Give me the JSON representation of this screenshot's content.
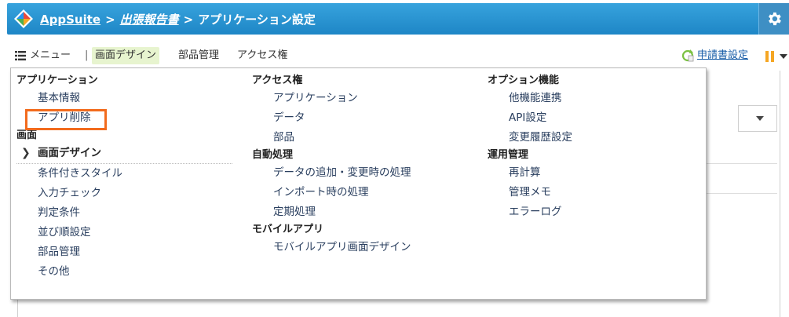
{
  "header": {
    "app_name": "AppSuite",
    "sep1": ">",
    "app_link": "出張報告書",
    "sep2": ">",
    "page_title": "アプリケーション設定"
  },
  "toolbar": {
    "menu_label": "メニュー",
    "divider": "|",
    "design_label": "画面デザイン",
    "parts_label": "部品管理",
    "access_label": "アクセス権",
    "request_label": "申請書設定"
  },
  "menu": {
    "col1": {
      "app_section": "アプリケーション",
      "app_items": [
        "基本情報",
        "アプリ削除"
      ],
      "screen_section": "画面",
      "screen_items": [
        "画面デザイン",
        "条件付きスタイル",
        "入力チェック",
        "判定条件",
        "並び順設定",
        "部品管理",
        "その他"
      ]
    },
    "col2": {
      "access_section": "アクセス権",
      "access_items": [
        "アプリケーション",
        "データ",
        "部品"
      ],
      "auto_section": "自動処理",
      "auto_items": [
        "データの追加・変更時の処理",
        "インポート時の処理",
        "定期処理"
      ],
      "mobile_section": "モバイルアプリ",
      "mobile_items": [
        "モバイルアプリ画面デザイン"
      ]
    },
    "col3": {
      "option_section": "オプション機能",
      "option_items": [
        "他機能連携",
        "API設定",
        "変更履歴設定"
      ],
      "ops_section": "運用管理",
      "ops_items": [
        "再計算",
        "管理メモ",
        "エラーログ"
      ]
    }
  },
  "colors": {
    "header_blue": "#2b93d2",
    "highlight_orange": "#f26b1d",
    "design_tab_bg": "#e7f4cf",
    "pause_icon": "#f5a623"
  }
}
